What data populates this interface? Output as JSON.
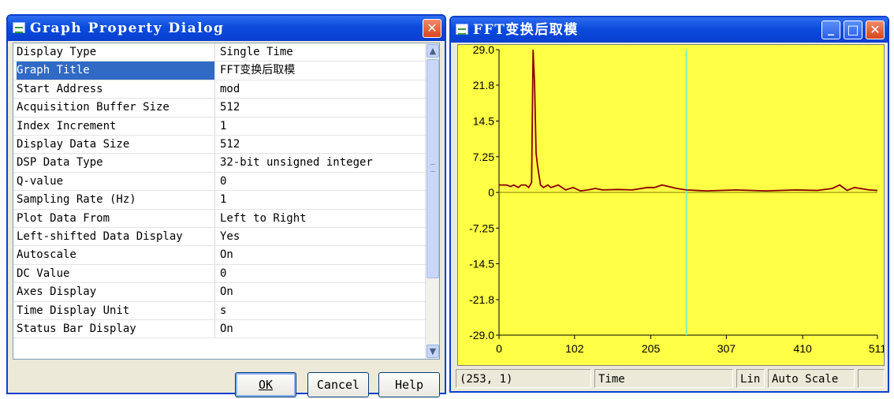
{
  "dialog": {
    "title": "Graph Property Dialog",
    "properties": [
      {
        "key": "Display Type",
        "value": "Single Time"
      },
      {
        "key": "Graph Title",
        "value": "FFT变换后取模"
      },
      {
        "key": "Start Address",
        "value": "mod"
      },
      {
        "key": "Acquisition Buffer Size",
        "value": "512"
      },
      {
        "key": "Index Increment",
        "value": "1"
      },
      {
        "key": "Display Data Size",
        "value": "512"
      },
      {
        "key": "DSP Data Type",
        "value": "32-bit unsigned integer"
      },
      {
        "key": "Q-value",
        "value": "0"
      },
      {
        "key": "Sampling Rate (Hz)",
        "value": "1"
      },
      {
        "key": "Plot Data From",
        "value": "Left to Right"
      },
      {
        "key": "Left-shifted Data Display",
        "value": "Yes"
      },
      {
        "key": "Autoscale",
        "value": "On"
      },
      {
        "key": "DC Value",
        "value": "0"
      },
      {
        "key": "Axes Display",
        "value": "On"
      },
      {
        "key": "Time Display Unit",
        "value": "s"
      },
      {
        "key": "Status Bar Display",
        "value": "On"
      }
    ],
    "selected_property": "Graph Title",
    "buttons": {
      "ok": "OK",
      "cancel": "Cancel",
      "help": "Help"
    },
    "close_glyph": "✕"
  },
  "graph_window": {
    "title": "FFT变换后取模",
    "glyphs": {
      "minimize": "_",
      "maximize": "□",
      "close": "✕"
    },
    "status": {
      "cursor": "(253, 1)",
      "axis": "Time",
      "scale": "Lin",
      "mode": "Auto Scale"
    },
    "colors": {
      "background": "#ffff45",
      "trace": "#8b0000",
      "cursor_line": "#80f0c0",
      "zero_line": "#808000"
    }
  },
  "chart_data": {
    "type": "line",
    "title": "FFT变换后取模",
    "xlabel": "",
    "ylabel": "",
    "xlim": [
      0,
      511
    ],
    "ylim": [
      -29.0,
      29.0
    ],
    "x_ticks": [
      "0",
      "102",
      "205",
      "307",
      "410",
      "511"
    ],
    "y_ticks": [
      "29.0",
      "21.8",
      "14.5",
      "7.25",
      "0",
      "-7.25",
      "-14.5",
      "-21.8",
      "-29.0"
    ],
    "cursor_x": 253,
    "grid": false,
    "series": [
      {
        "x": [
          0,
          8,
          10,
          16,
          20,
          26,
          30,
          36,
          40,
          44,
          46,
          48,
          50,
          52,
          54,
          56,
          60,
          66,
          70,
          80,
          90,
          100,
          110,
          120,
          130,
          140,
          160,
          180,
          200,
          210,
          220,
          240,
          253,
          280,
          320,
          360,
          400,
          430,
          450,
          460,
          470,
          480,
          500,
          511
        ],
        "y": [
          1.5,
          1.5,
          1.5,
          1.2,
          1.5,
          1.0,
          1.5,
          1.5,
          1.0,
          2.0,
          29.0,
          22.0,
          8.0,
          5.5,
          3.5,
          1.5,
          1.0,
          1.5,
          1.0,
          1.5,
          0.5,
          1.0,
          0.3,
          0.5,
          0.8,
          0.5,
          0.6,
          0.5,
          1.0,
          1.0,
          1.5,
          0.8,
          0.5,
          0.3,
          0.5,
          0.3,
          0.5,
          0.4,
          0.8,
          1.5,
          0.4,
          1.0,
          0.5,
          0.4
        ]
      }
    ]
  }
}
